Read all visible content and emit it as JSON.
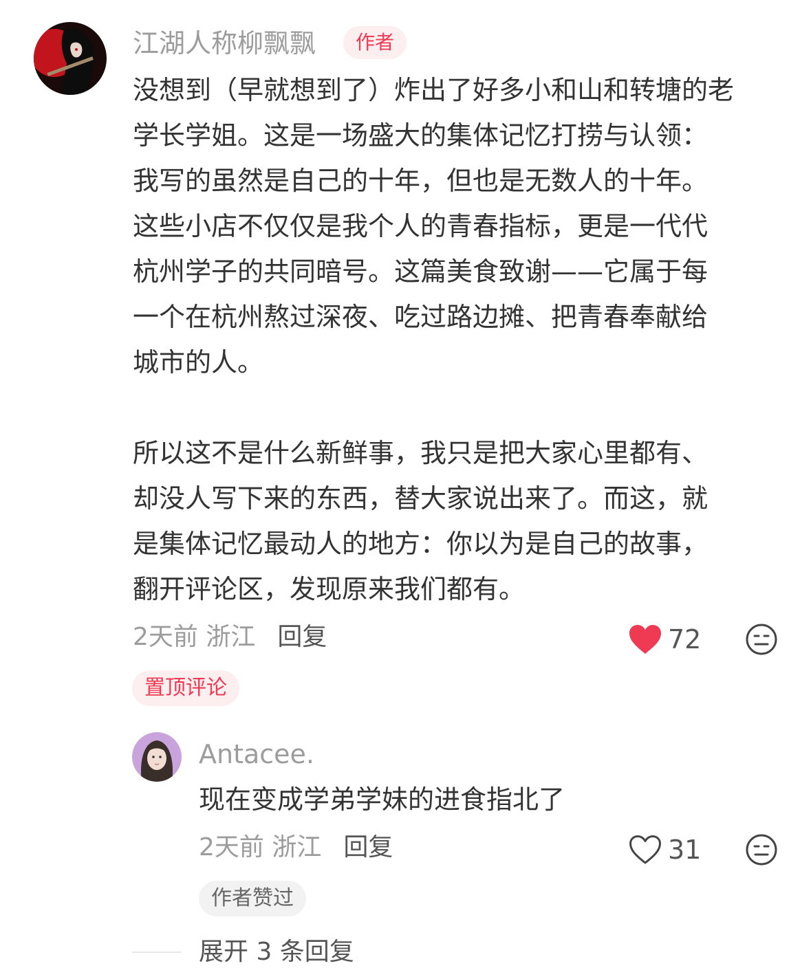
{
  "comment": {
    "username": "江湖人称柳飘飘",
    "author_badge": "作者",
    "lines": [
      "没想到（早就想到了）炸出了好多小和山和转塘的老",
      "学长学姐。这是一场盛大的集体记忆打捞与认领：",
      "我写的虽然是自己的十年，但也是无数人的十年。",
      "这些小店不仅仅是我个人的青春指标，更是一代代",
      "杭州学子的共同暗号。这篇美食致谢——它属于每",
      "一个在杭州熬过深夜、吃过路边摊、把青春奉献给",
      "城市的人。",
      "所以这不是什么新鲜事，我只是把大家心里都有、",
      "却没人写下来的东西，替大家说出来了。而这，就",
      "是集体记忆最动人的地方：你以为是自己的故事，",
      "翻开评论区，发现原来我们都有。"
    ],
    "meta": "2天前 浙江",
    "reply_label": "回复",
    "like_count": "72",
    "liked": true,
    "pinned_label": "置顶评论"
  },
  "reply": {
    "username": "Antacee.",
    "text": "现在变成学弟学妹的进食指北了",
    "meta": "2天前 浙江",
    "reply_label": "回复",
    "like_count": "31",
    "liked": false,
    "author_liked_label": "作者赞过"
  },
  "expand_label": "展开 3 条回复",
  "colors": {
    "accent_red": "#ee3a52",
    "badge_bg": "#fdeef0",
    "muted_text": "#9c9c9c"
  }
}
